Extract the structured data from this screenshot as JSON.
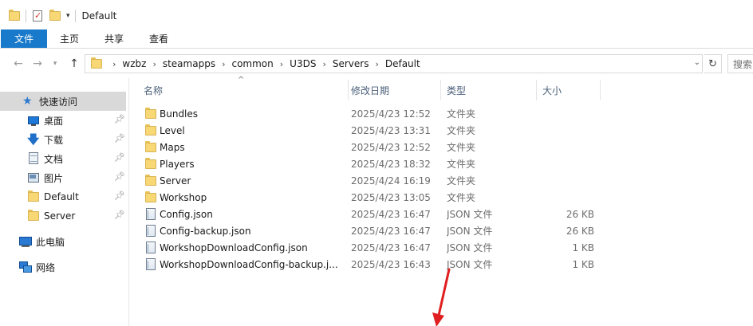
{
  "window": {
    "title": "Default"
  },
  "ribbon": {
    "tabs": [
      {
        "label": "文件"
      },
      {
        "label": "主页"
      },
      {
        "label": "共享"
      },
      {
        "label": "查看"
      }
    ]
  },
  "address": {
    "crumbs": [
      "wzbz",
      "steamapps",
      "common",
      "U3DS",
      "Servers",
      "Default"
    ],
    "search_placeholder": "搜索"
  },
  "sidebar": {
    "quick_access": "快速访问",
    "items": [
      {
        "label": "桌面",
        "icon": "desktop-icon",
        "pinned": true
      },
      {
        "label": "下载",
        "icon": "download-icon",
        "pinned": true
      },
      {
        "label": "文档",
        "icon": "documents-icon",
        "pinned": true
      },
      {
        "label": "图片",
        "icon": "pictures-icon",
        "pinned": true
      },
      {
        "label": "Default",
        "icon": "folder-icon",
        "pinned": true
      },
      {
        "label": "Server",
        "icon": "folder-icon",
        "pinned": true
      }
    ],
    "this_pc": "此电脑",
    "network": "网络"
  },
  "filelist": {
    "columns": {
      "name": "名称",
      "date": "修改日期",
      "type": "类型",
      "size": "大小"
    },
    "rows": [
      {
        "name": "Bundles",
        "date": "2025/4/23 12:52",
        "type": "文件夹",
        "size": "",
        "kind": "folder"
      },
      {
        "name": "Level",
        "date": "2025/4/23 13:31",
        "type": "文件夹",
        "size": "",
        "kind": "folder"
      },
      {
        "name": "Maps",
        "date": "2025/4/23 12:52",
        "type": "文件夹",
        "size": "",
        "kind": "folder"
      },
      {
        "name": "Players",
        "date": "2025/4/23 18:32",
        "type": "文件夹",
        "size": "",
        "kind": "folder"
      },
      {
        "name": "Server",
        "date": "2025/4/24 16:19",
        "type": "文件夹",
        "size": "",
        "kind": "folder"
      },
      {
        "name": "Workshop",
        "date": "2025/4/23 13:05",
        "type": "文件夹",
        "size": "",
        "kind": "folder"
      },
      {
        "name": "Config.json",
        "date": "2025/4/23 16:47",
        "type": "JSON 文件",
        "size": "26 KB",
        "kind": "json"
      },
      {
        "name": "Config-backup.json",
        "date": "2025/4/23 16:47",
        "type": "JSON 文件",
        "size": "26 KB",
        "kind": "json"
      },
      {
        "name": "WorkshopDownloadConfig.json",
        "date": "2025/4/23 16:47",
        "type": "JSON 文件",
        "size": "1 KB",
        "kind": "json"
      },
      {
        "name": "WorkshopDownloadConfig-backup.j...",
        "date": "2025/4/23 16:43",
        "type": "JSON 文件",
        "size": "1 KB",
        "kind": "json"
      }
    ]
  },
  "colors": {
    "file_tab": "#1979ca",
    "folder": "#f8d775",
    "annotation_arrow": "#e02020",
    "header_text": "#4c607a"
  }
}
